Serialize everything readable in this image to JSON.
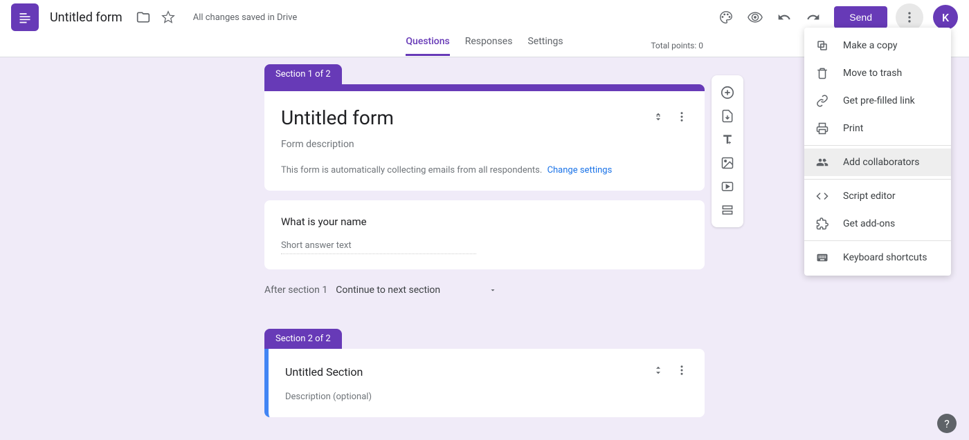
{
  "header": {
    "title": "Untitled form",
    "saveStatus": "All changes saved in Drive",
    "sendLabel": "Send",
    "avatarInitial": "K"
  },
  "tabs": {
    "questions": "Questions",
    "responses": "Responses",
    "settings": "Settings"
  },
  "totalPoints": "Total points: 0",
  "section1": {
    "tabLabel": "Section 1 of 2",
    "title": "Untitled form",
    "description": "Form description",
    "autoCollect": "This form is automatically collecting emails from all respondents.",
    "changeSettings": "Change settings",
    "question1": "What is your name",
    "shortAnswer": "Short answer text",
    "afterLabel": "After section 1",
    "continueLabel": "Continue to next section"
  },
  "section2": {
    "tabLabel": "Section 2 of 2",
    "title": "Untitled Section",
    "description": "Description (optional)"
  },
  "menu": {
    "makeCopy": "Make a copy",
    "moveToTrash": "Move to trash",
    "getPrefilled": "Get pre-filled link",
    "print": "Print",
    "addCollaborators": "Add collaborators",
    "scriptEditor": "Script editor",
    "getAddons": "Get add-ons",
    "keyboardShortcuts": "Keyboard shortcuts"
  }
}
